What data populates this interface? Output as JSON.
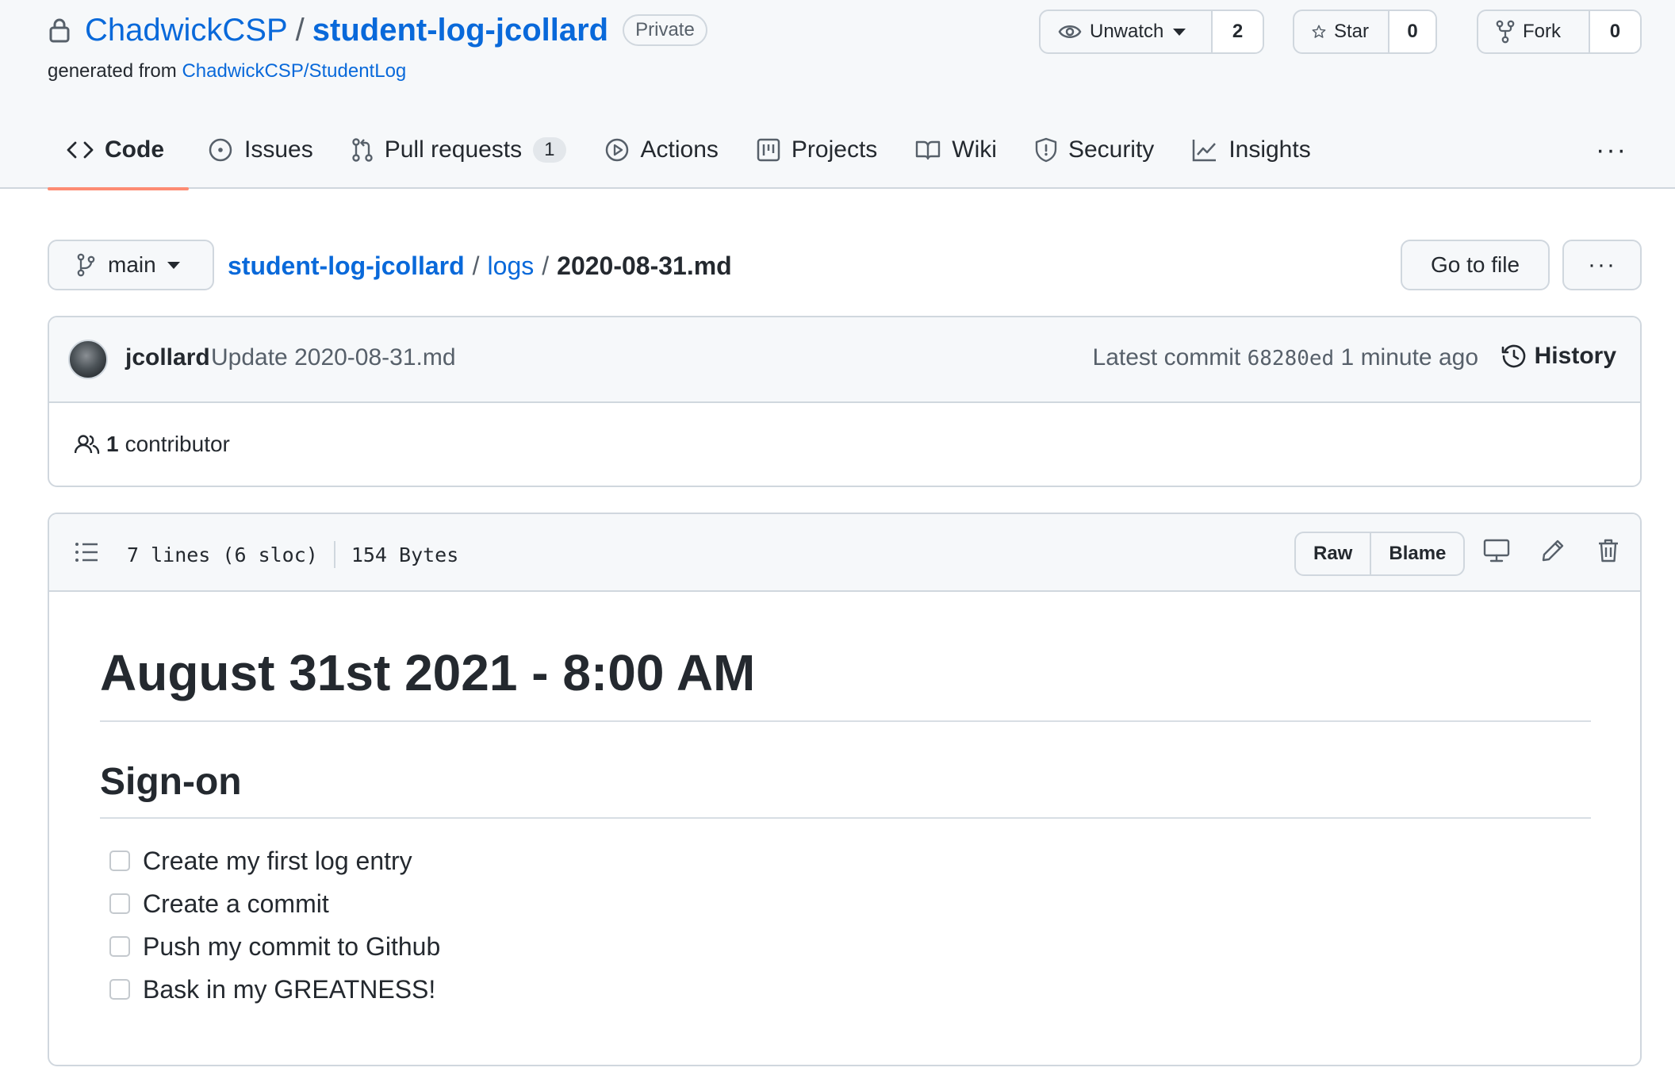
{
  "repo": {
    "owner": "ChadwickCSP",
    "separator": "/",
    "name": "student-log-jcollard",
    "visibility": "Private",
    "generated_prefix": "generated from",
    "template": "ChadwickCSP/StudentLog"
  },
  "actions": {
    "watch": {
      "label": "Unwatch",
      "count": "2",
      "icon": "eye-icon"
    },
    "star": {
      "label": "Star",
      "count": "0",
      "icon": "star-icon"
    },
    "fork": {
      "label": "Fork",
      "count": "0",
      "icon": "repo-forked-icon"
    }
  },
  "tabs": [
    {
      "label": "Code",
      "icon": "code-icon",
      "active": true
    },
    {
      "label": "Issues",
      "icon": "issue-opened-icon"
    },
    {
      "label": "Pull requests",
      "icon": "git-pull-request-icon",
      "counter": "1"
    },
    {
      "label": "Actions",
      "icon": "play-icon"
    },
    {
      "label": "Projects",
      "icon": "project-icon"
    },
    {
      "label": "Wiki",
      "icon": "book-icon"
    },
    {
      "label": "Security",
      "icon": "shield-icon"
    },
    {
      "label": "Insights",
      "icon": "graph-icon"
    }
  ],
  "tabs_more": "···",
  "file_nav": {
    "branch": "main",
    "breadcrumb": {
      "repo": "student-log-jcollard",
      "sep": "/",
      "dir": "logs",
      "file": "2020-08-31.md"
    },
    "go_to_file": "Go to file",
    "more": "···"
  },
  "commit": {
    "author": "jcollard",
    "message": "Update 2020-08-31.md",
    "latest_label": "Latest commit",
    "sha": "68280ed",
    "time": "1 minute ago",
    "history_label": "History",
    "contributors_count": "1",
    "contributors_label": "contributor"
  },
  "file": {
    "lines": "7 lines (6 sloc)",
    "size": "154 Bytes",
    "raw_label": "Raw",
    "blame_label": "Blame"
  },
  "markdown": {
    "h1": "August 31st 2021 - 8:00 AM",
    "h2": "Sign-on",
    "tasks": [
      "Create my first log entry",
      "Create a commit",
      "Push my commit to Github",
      "Bask in my GREATNESS!"
    ]
  },
  "colors": {
    "link": "#0969da",
    "text": "#24292f",
    "muted": "#57606a",
    "border": "#d0d7de",
    "header_bg": "#f6f8fa",
    "active_tab_underline": "#fd8c73"
  }
}
